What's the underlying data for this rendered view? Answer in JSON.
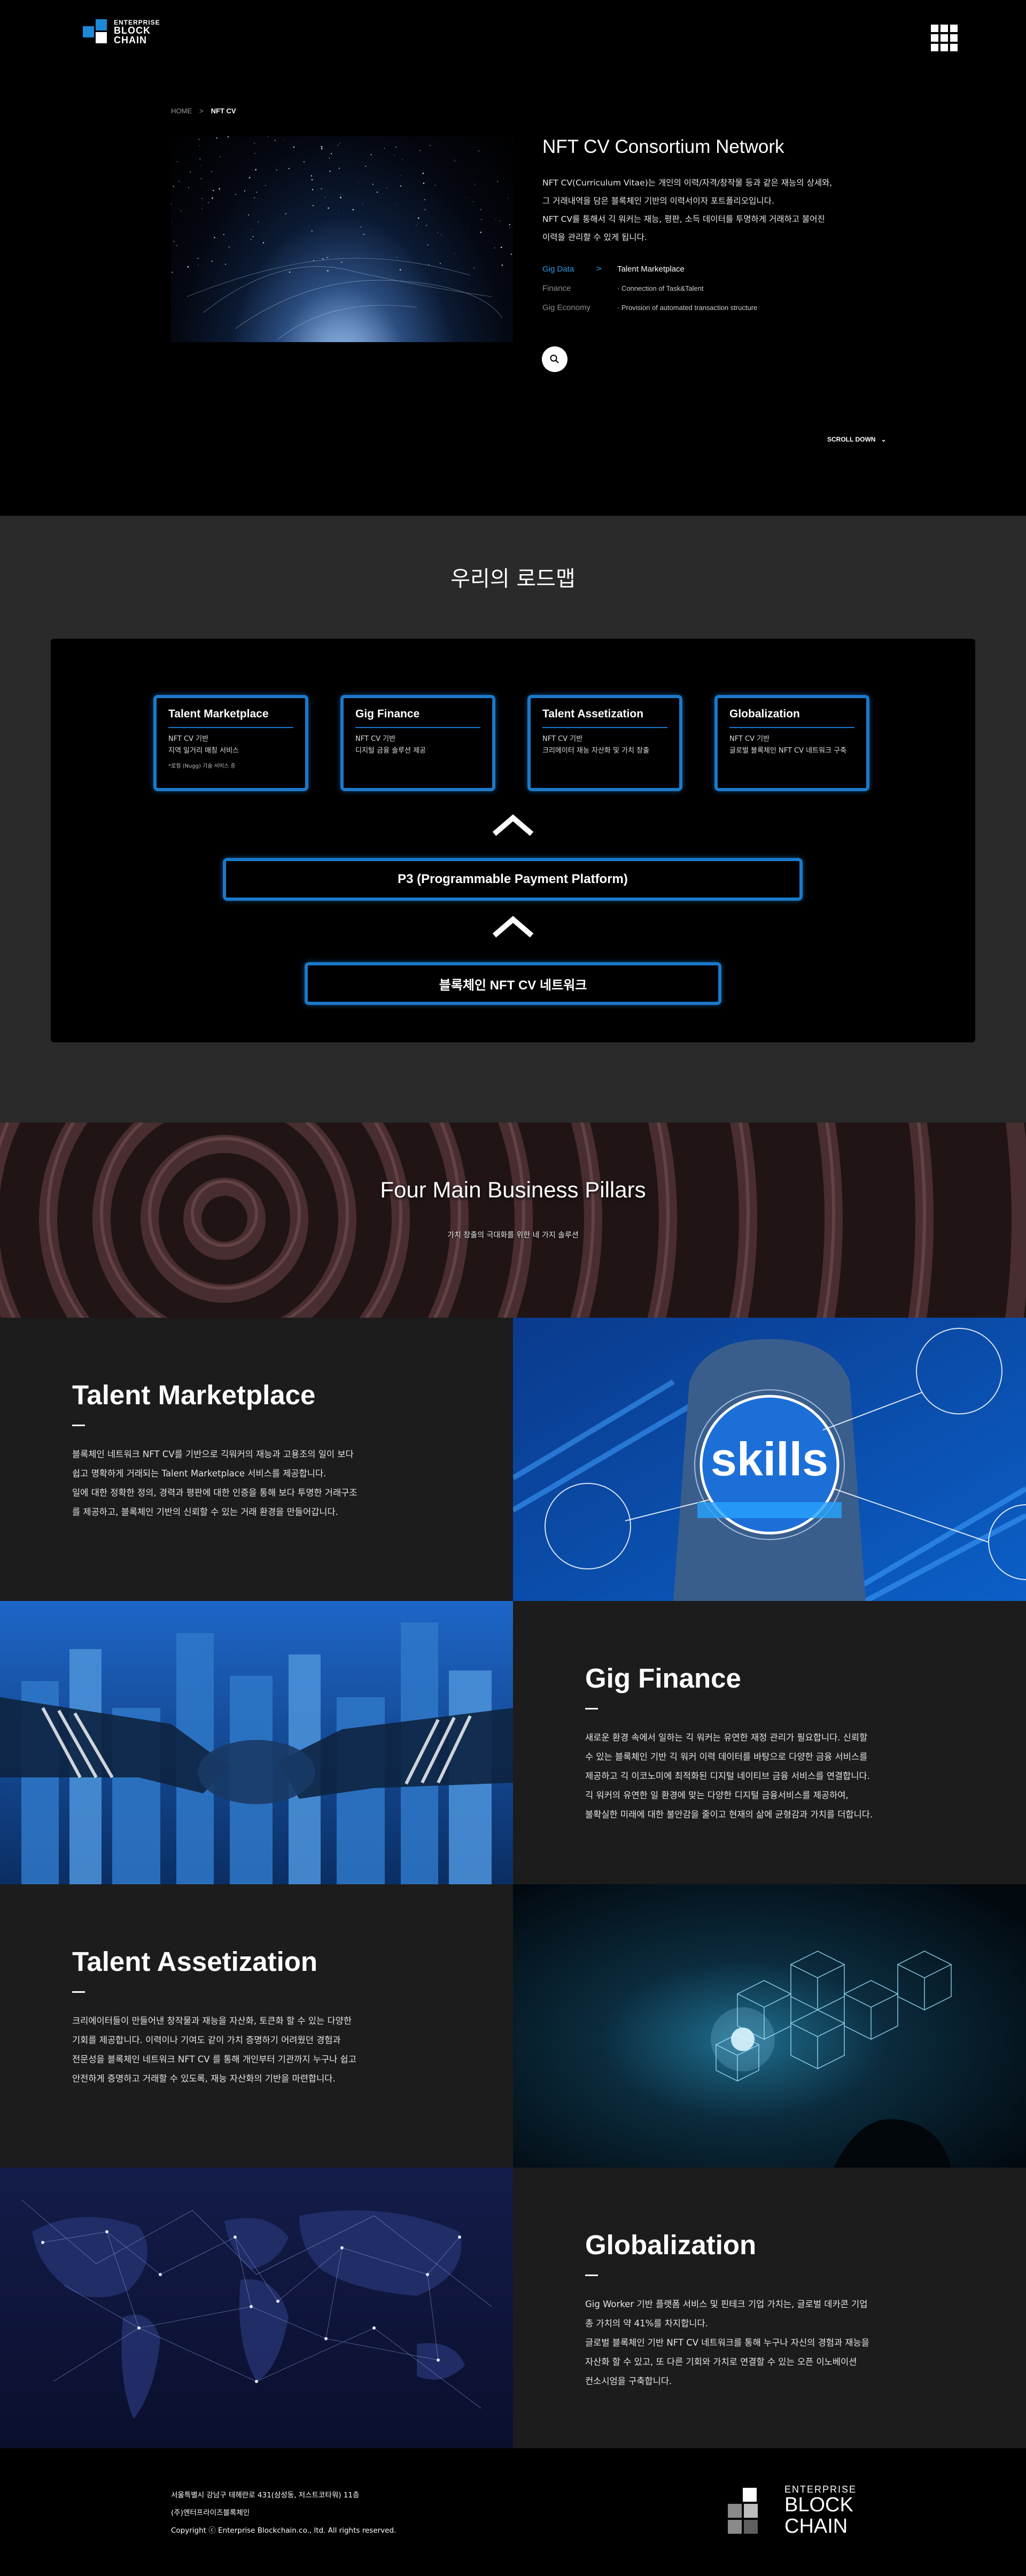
{
  "header": {
    "logo_line1": "ENTERPRISE",
    "logo_line2": "BLOCK",
    "logo_line3": "CHAIN",
    "menu_icon": "grid-menu-icon"
  },
  "breadcrumb": {
    "home": "HOME",
    "separator": ">",
    "current": "NFT CV"
  },
  "hero": {
    "title": "NFT CV Consortium Network",
    "desc_1": "NFT CV(Curriculum Vitae)는 개인의 이력/자격/창작물 등과 같은 재능의 상세와,",
    "desc_2": "그 거래내역을 담은 블록체인 기반의 이력서이자 포트폴리오입니다.",
    "desc_3": "NFT CV를 통해서 긱 워커는 재능, 평판, 소득 데이터를 투명하게 거래하고 불어진",
    "desc_4": "이력을 관리할 수 있게 됩니다.",
    "tabs": [
      {
        "label": "Gig Data",
        "content": "Talent Marketplace"
      },
      {
        "label": "Finance",
        "content": "· Connection of Task&Talent"
      },
      {
        "label": "Gig Economy",
        "content": "· Provision of automated transaction structure"
      }
    ],
    "scroll_down": "SCROLL DOWN",
    "scroll_arrow": "⌄"
  },
  "roadmap": {
    "title": "우리의 로드맵",
    "cards": [
      {
        "title": "Talent Marketplace",
        "line1": "NFT CV 기반",
        "line2": "지역 일거리 매칭 서비스",
        "note": "*로컬 (Nugg) 기술 서비스 중"
      },
      {
        "title": "Gig Finance",
        "line1": "NFT CV 기반",
        "line2": "디지털 금융 솔루션 제공",
        "note": ""
      },
      {
        "title": "Talent Assetization",
        "line1": "NFT CV 기반",
        "line2": "크리에이터 재능 자산화 및 가치 창출",
        "note": ""
      },
      {
        "title": "Globalization",
        "line1": "NFT CV 기반",
        "line2": "글로벌 블록체인 NFT CV 네트워크 구축",
        "note": ""
      }
    ],
    "platform": "P3 (Programmable Payment Platform)",
    "network": "블록체인 NFT CV 네트워크"
  },
  "pillars": {
    "title": "Four Main Business Pillars",
    "subtitle": "가치 창출의 극대화를 위한 네 가지 솔루션"
  },
  "features": [
    {
      "title": "Talent Marketplace",
      "lines": [
        "블록체인 네트워크 NFT CV를 기반으로 긱워커의 재능과 고용조의 일이 보다",
        "쉽고 명확하게 거래되는 Talent Marketplace 서비스를 제공합니다.",
        "일에 대한 정확한 정의, 경력과 평판에 대한 인증을 통해 보다 투명한 거래구조",
        "를 제공하고, 블록체인 기반의 신뢰할 수 있는 거래 환경을 만들어갑니다."
      ],
      "image_label": "skills"
    },
    {
      "title": "Gig Finance",
      "lines": [
        "새로운 환경 속에서 일하는 긱 워커는 유연한 재정 관리가 필요합니다. 신뢰할",
        "수 있는 블록체인 기반 긱 워커 이력 데이터를 바탕으로 다양한 금융 서비스를",
        "제공하고 긱 이코노미에 최적화된 디지털 네이티브 금융 서비스를 연결합니다.",
        "긱 워커의 유연한 일 환경에 맞는 다양한 디지털 금융서비스를 제공하여,",
        "불확실한 미래에 대한 불안감을 줄이고 현재의 삶에 균형감과 가치를 더합니다."
      ]
    },
    {
      "title": "Talent Assetization",
      "lines": [
        "크리에이터들이 만들어낸 창작물과 재능을 자산화, 토큰화 할 수 있는 다양한",
        "기회를 제공합니다. 이력이나 기여도 같이 가치 증명하기 어려웠던 경험과",
        "전문성을 블록체인 네트워크 NFT CV 를 통해 개인부터 기관까지 누구나 쉽고",
        "안전하게 증명하고 거래할 수 있도록, 재능 자산화의 기반을 마련합니다."
      ]
    },
    {
      "title": "Globalization",
      "lines": [
        "Gig Worker 기반 플랫폼 서비스 및 핀테크 기업 가치는, 글로벌 데카콘 기업",
        "총 가치의 약 41%를 차지합니다.",
        "글로벌 블록체인 기반 NFT CV 네트워크를 통해 누구나 자신의 경험과 재능을",
        "자산화 할 수 있고, 또 다른 기회와 가치로 연결할 수 있는 오픈 이노베이션",
        "컨소시엄을 구축합니다."
      ]
    }
  ],
  "footer": {
    "address": "서울특별시 강남구 테헤란로 431(삼성동, 저스트코타워) 11층",
    "company": "(주)엔터프라이즈블록체인",
    "copyright": "Copyright ⓒ Enterprise Blockchain.co., ltd. All rights reserved.",
    "logo_line1": "ENTERPRISE",
    "logo_line2": "BLOCK",
    "logo_line3": "CHAIN"
  },
  "colors": {
    "accent_blue": "#1b79c9",
    "tab_active": "#2f9be3",
    "logo_blue": "#1e88d6"
  }
}
